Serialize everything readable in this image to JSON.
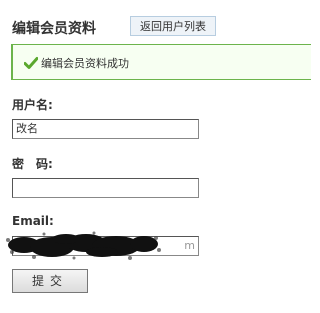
{
  "header": {
    "title": "编辑会员资料",
    "back_button_label": "返回用户列表"
  },
  "notice": {
    "icon": "check-icon",
    "message": "编辑会员资料成功",
    "color": "#6cb44c"
  },
  "form": {
    "username": {
      "label": "用户名:",
      "value": "改名"
    },
    "password": {
      "label": "密　码:",
      "value": ""
    },
    "email": {
      "label": "Email:",
      "value_visible_suffix": "m",
      "obscured": true
    },
    "submit_label": "提交"
  }
}
